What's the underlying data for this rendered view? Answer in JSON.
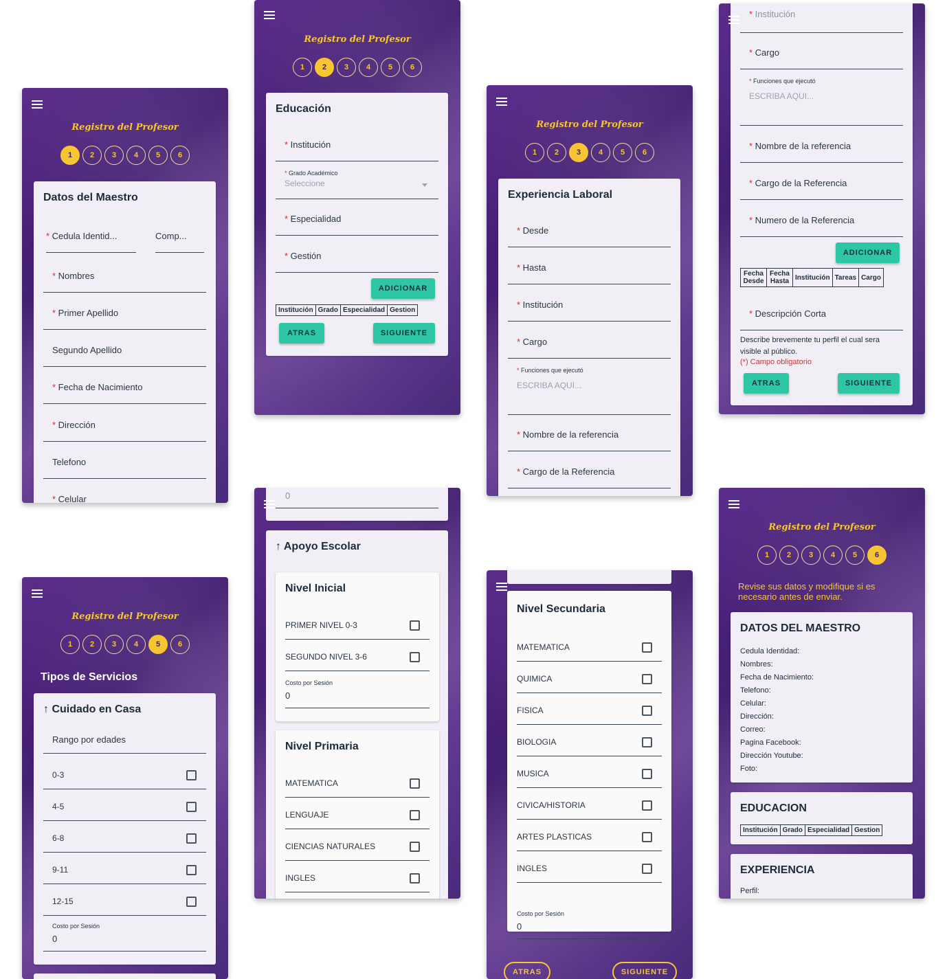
{
  "app": {
    "title": "Registro del Profesor",
    "menu_icon": "hamburger-menu-icon"
  },
  "steps": [
    "1",
    "2",
    "3",
    "4",
    "5",
    "6"
  ],
  "colors": {
    "accent": "#f7c531",
    "button": "#2ec7a5",
    "required": "#d32f2f",
    "background": "#4a2a7a"
  },
  "s1": {
    "heading": "Datos del Maestro",
    "cedula": "Cedula Identid...",
    "comp": "Comp...",
    "nombres": "Nombres",
    "primer": "Primer Apellido",
    "segundo": "Segundo Apellido",
    "fecha": "Fecha de Nacimiento",
    "direccion": "Dirección",
    "telefono": "Telefono",
    "celular": "Celular"
  },
  "s2": {
    "heading": "Educación",
    "institucion": "Institución",
    "grado_label": "Grado Académico",
    "grado_ph": "Seleccione",
    "especialidad": "Especialidad",
    "gestion": "Gestión",
    "adicionar": "ADICIONAR",
    "cols": [
      "Institución",
      "Grado",
      "Especialidad",
      "Gestion"
    ],
    "atras": "ATRAS",
    "siguiente": "SIGUIENTE"
  },
  "s3": {
    "heading": "Experiencia Laboral",
    "desde": "Desde",
    "hasta": "Hasta",
    "institucion": "Institución",
    "cargo": "Cargo",
    "funciones": "Funciones que ejecutó",
    "funciones_ph": "ESCRIBA AQUI...",
    "nombre_ref": "Nombre de la referencia",
    "cargo_ref": "Cargo de la Referencia"
  },
  "s3b": {
    "institucion": "Institución",
    "cargo": "Cargo",
    "funciones": "Funciones que ejecutó",
    "funciones_ph": "ESCRIBA AQUI...",
    "nombre_ref": "Nombre de la referencia",
    "cargo_ref": "Cargo de la Referencia",
    "numero_ref": "Numero de la Referencia",
    "adicionar": "ADICIONAR",
    "cols": [
      "Fecha Desde",
      "Fecha Hasta",
      "Institución",
      "Tareas",
      "Cargo"
    ],
    "descripcion": "Descripción Corta",
    "help": "Describe brevemente tu perfil el cual sera visible al público.",
    "obligatorio": "(*) Campo obligatorio",
    "atras": "ATRAS",
    "siguiente": "SIGUIENTE"
  },
  "s5": {
    "heading": "Tipos de Servicios",
    "section": "Cuidado en Casa",
    "rango": "Rango por edades",
    "ages": [
      "0-3",
      "4-5",
      "6-8",
      "9-11",
      "12-15"
    ],
    "costo_label": "Costo por Sesión",
    "costo": "0"
  },
  "s5b": {
    "top_value": "0",
    "section": "Apoyo Escolar",
    "inicial": "Nivel Inicial",
    "inicial_items": [
      "PRIMER NIVEL 0-3",
      "SEGUNDO NIVEL 3-6"
    ],
    "costo_label": "Costo por Sesión",
    "costo": "0",
    "primaria": "Nivel Primaria",
    "primaria_items": [
      "MATEMATICA",
      "LENGUAJE",
      "CIENCIAS NATURALES",
      "INGLES"
    ]
  },
  "s5c": {
    "secundaria": "Nivel Secundaria",
    "items": [
      "MATEMATICA",
      "QUIMICA",
      "FISICA",
      "BIOLOGIA",
      "MUSICA",
      "CIVICA/HISTORIA",
      "ARTES PLASTICAS",
      "INGLES"
    ],
    "costo_label": "Costo por Sesión",
    "costo": "0",
    "atras": "ATRAS",
    "siguiente": "SIGUIENTE"
  },
  "s6": {
    "note": "Revise sus datos y modifique si es necesario antes de enviar.",
    "datos": "DATOS DEL MAESTRO",
    "fields": [
      "Cedula Identidad:",
      "Nombres:",
      "Fecha de Nacimiento:",
      "Telefono:",
      "Celular:",
      "Dirección:",
      "Correo:",
      "Pagina Facebook:",
      "Dirección Youtube:",
      "Foto:"
    ],
    "educacion": "EDUCACION",
    "edu_cols": [
      "Institución",
      "Grado",
      "Especialidad",
      "Gestion"
    ],
    "experiencia": "EXPERIENCIA",
    "perfil": "Perfil:"
  }
}
